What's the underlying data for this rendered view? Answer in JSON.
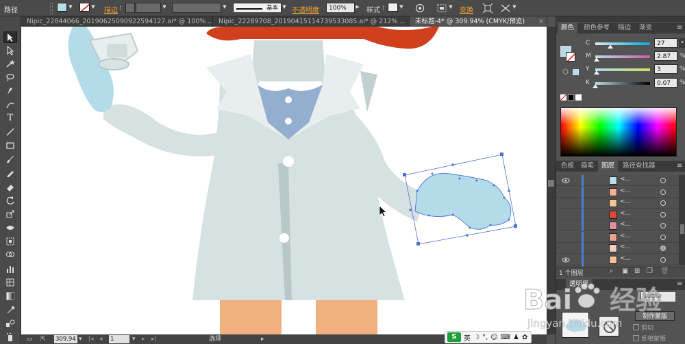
{
  "control_bar": {
    "path_label": "路径",
    "stroke_label": "描边",
    "stroke_value": "",
    "brush_label": "基本",
    "opacity_label": "不透明度",
    "opacity_value": "100%",
    "style_label": "样式",
    "transform_label": "变换"
  },
  "tabs": [
    {
      "label": "Nipic_22844066_20190625090922594127.ai* @ 100% ..."
    },
    {
      "label": "Nipic_22289708_20190415114739533085.ai* @ 212% ..."
    },
    {
      "label": "未标题-4* @ 309.94% (CMYK/预览)"
    }
  ],
  "status_bar": {
    "zoom": "309.94",
    "artboard": "1",
    "tool": "选择"
  },
  "color_panel": {
    "tabs": [
      "颜色",
      "颜色参考",
      "描边",
      "渐变"
    ],
    "channels": [
      {
        "name": "C",
        "value": "27",
        "fraction": 0.27,
        "color": "#00a8e0"
      },
      {
        "name": "M",
        "value": "2.87",
        "fraction": 0.03,
        "color": "#e0007a"
      },
      {
        "name": "Y",
        "value": "3",
        "fraction": 0.03,
        "color": "#f0e000"
      },
      {
        "name": "K",
        "value": "0.07",
        "fraction": 0.0,
        "color": "#000000"
      }
    ],
    "percent_sign": "%"
  },
  "layers_panel": {
    "tabs": [
      "色板",
      "画笔",
      "图层",
      "路径查找器"
    ],
    "rows": [
      {
        "name": "<...",
        "visible": true,
        "thumb": "#b8dde8",
        "target_filled": false
      },
      {
        "name": "<...",
        "visible": false,
        "thumb": "#f0b090",
        "target_filled": false
      },
      {
        "name": "<...",
        "visible": false,
        "thumb": "#f4c09a",
        "target_filled": false
      },
      {
        "name": "<...",
        "visible": false,
        "thumb": "#d84a3a",
        "target_filled": false
      },
      {
        "name": "<...",
        "visible": false,
        "thumb": "#e090a0",
        "target_filled": false
      },
      {
        "name": "<...",
        "visible": false,
        "thumb": "#e8a090",
        "target_filled": false
      },
      {
        "name": "<...",
        "visible": false,
        "thumb": "#f0d0c0",
        "target_filled": true
      },
      {
        "name": "<...",
        "visible": true,
        "thumb": "#f4c09a",
        "target_filled": false
      },
      {
        "name": "<...",
        "visible": true,
        "thumb": "#222222",
        "target_filled": false
      }
    ],
    "footer": "1 个图层"
  },
  "transparency_panel": {
    "title": "透明度",
    "opacity": "100%",
    "make_mask": "制作蒙版",
    "clip": "剪切",
    "invert": "反相蒙版"
  },
  "ime": {
    "logo": "S",
    "lang": "英"
  },
  "watermark": {
    "text": "Bai经验",
    "url": "jingyan.baidu.com"
  }
}
